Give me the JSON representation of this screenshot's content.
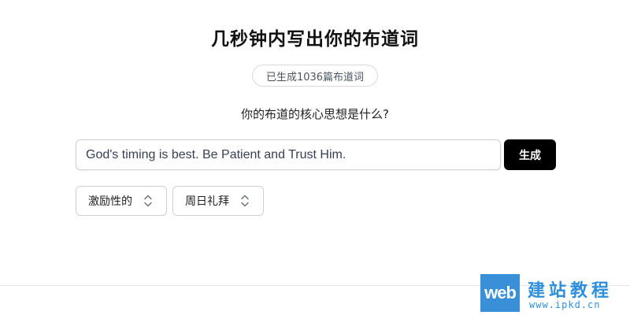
{
  "header": {
    "title": "几秒钟内写出你的布道词"
  },
  "counter": {
    "text": "已生成1036篇布道词"
  },
  "form": {
    "question": "你的布道的核心思想是什么?",
    "input_value": "God's timing is best. Be Patient and Trust Him.",
    "generate_label": "生成",
    "tone_select": {
      "value": "激励性的",
      "icon": "chevron-up-down-icon"
    },
    "occasion_select": {
      "value": "周日礼拜",
      "icon": "chevron-up-down-icon"
    }
  },
  "watermark": {
    "logo_text": "web",
    "site_name": "建站教程",
    "url": "www.ipkd.cn"
  },
  "colors": {
    "button_bg": "#000000",
    "watermark_blue": "#3a8fd9"
  }
}
